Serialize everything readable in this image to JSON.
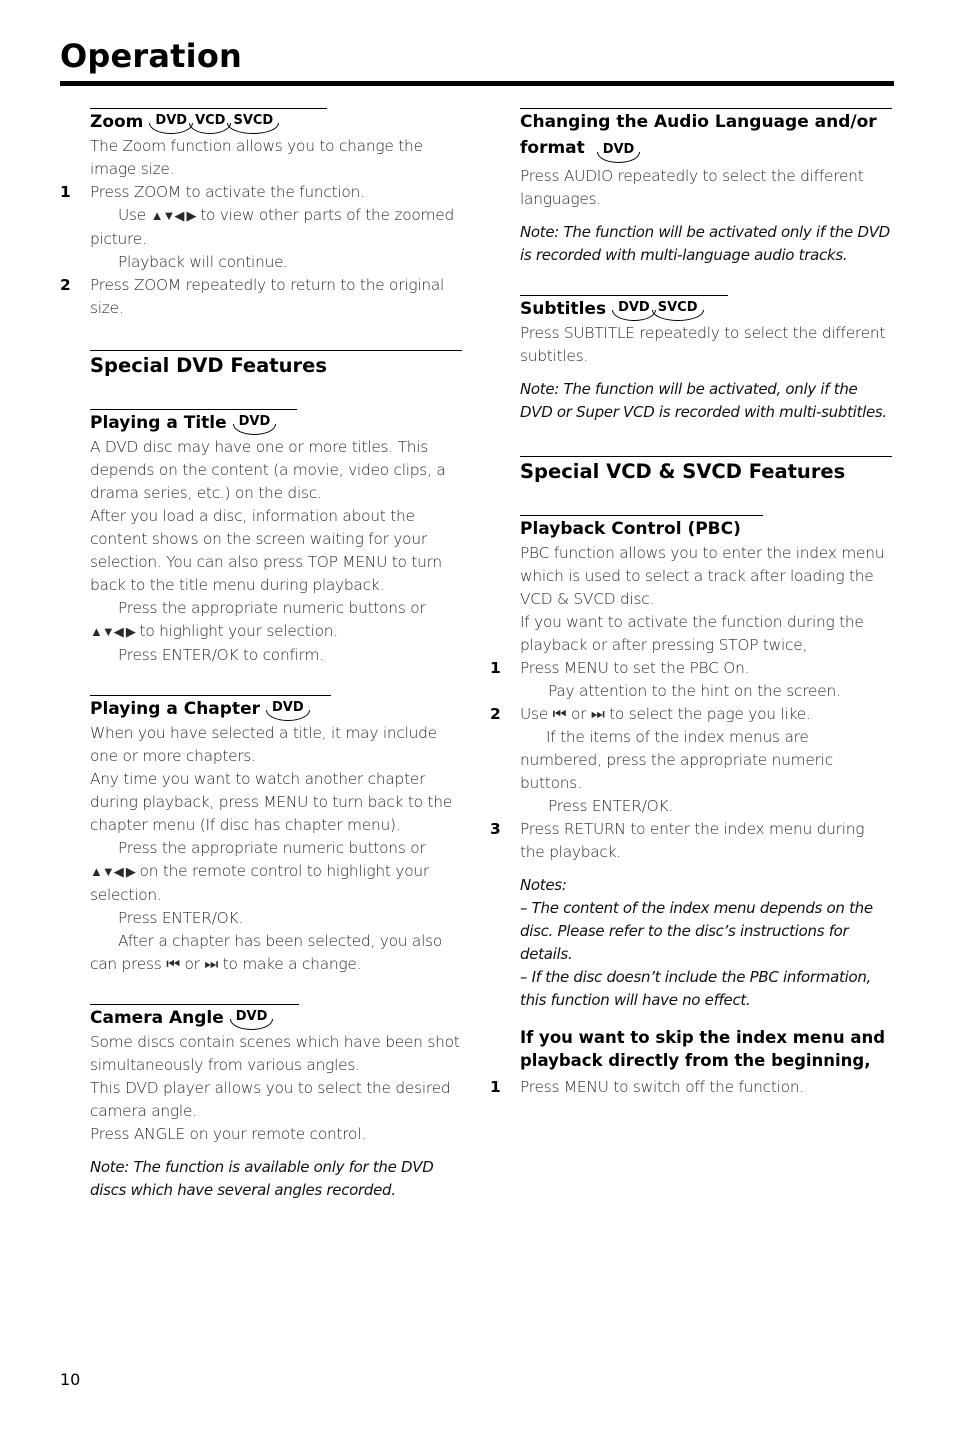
{
  "page": {
    "title": "Operation",
    "number": "10"
  },
  "zoom": {
    "heading": "Zoom",
    "badges": [
      "DVD",
      "VCD",
      "SVCD"
    ],
    "intro": "The Zoom function allows you to change the image size.",
    "step1_num": "1",
    "step1": "Press ZOOM to activate the function.",
    "step1_sub_pre": "Use",
    "arrows": "▲▼◀ ▶",
    "step1_sub_post": "to view other parts of the zoomed picture.",
    "step1_sub2": "Playback will continue.",
    "step2_num": "2",
    "step2": "Press ZOOM repeatedly to return to the original size."
  },
  "special_dvd": {
    "heading": "Special DVD Features"
  },
  "playing_title": {
    "heading": "Playing a Title",
    "badge": "DVD",
    "p1": "A DVD disc may have one or more titles. This depends on the content (a movie, video clips, a drama series, etc.) on the disc.",
    "p2": "After you load a disc, information about the content shows on the screen waiting for your selection. You can also press TOP MENU to turn back to the title menu during playback.",
    "p3_pre": "Press the appropriate numeric buttons or",
    "arrows": "▲▼◀ ▶",
    "p3_post": "to highlight your selection.",
    "p4": "Press ENTER/OK to confirm."
  },
  "playing_chapter": {
    "heading": "Playing a Chapter",
    "badge": "DVD",
    "p1": "When you have selected a title, it may include one or more chapters.",
    "p2": "Any time you want to watch another chapter during playback, press MENU to turn back to the chapter menu (If disc has chapter menu).",
    "p3_pre": "Press the appropriate numeric buttons or",
    "arrows": "▲▼◀ ▶",
    "p3_post": "on the remote control to highlight your selection.",
    "p4": "Press ENTER/OK.",
    "p5_pre": "After a chapter has been selected, you also can press",
    "prev_icon": "⏮",
    "or": "or",
    "next_icon": "⏭",
    "p5_post": "to make a change."
  },
  "camera_angle": {
    "heading": "Camera Angle",
    "badge": "DVD",
    "p1": "Some discs contain scenes which have been shot simultaneously from various angles.",
    "p2": "This DVD player allows you to select the desired camera angle.",
    "p3": "Press ANGLE on your remote control.",
    "note": "Note: The function is available only for the DVD discs which have several angles recorded."
  },
  "audio_language": {
    "heading_line1": "Changing the Audio Language and/or",
    "heading_line2": "format",
    "badge": "DVD",
    "p1": "Press AUDIO repeatedly to select the different languages.",
    "note": "Note: The function will be activated only if the DVD is recorded with multi-language audio tracks."
  },
  "subtitles": {
    "heading": "Subtitles",
    "badges": [
      "DVD",
      "SVCD"
    ],
    "p1": "Press SUBTITLE repeatedly to select the different subtitles.",
    "note": "Note: The function will be activated, only if the DVD or Super VCD is recorded with multi-subtitles."
  },
  "special_vcd": {
    "heading": "Special VCD & SVCD Features"
  },
  "pbc": {
    "heading": "Playback Control (PBC)",
    "p1": "PBC function allows you to enter the index menu which is used to select a track after loading the VCD & SVCD disc.",
    "p2": "If you want to activate the function during the playback or after pressing STOP twice,",
    "step1_num": "1",
    "step1": "Press MENU to set the PBC On.",
    "step1_sub": "Pay attention to the hint on the screen.",
    "step2_num": "2",
    "step2_pre": "Use",
    "prev_icon": "⏮",
    "or": "or",
    "next_icon": "⏭",
    "step2_post": "to select the page you like.",
    "step2_sub1": "If the items of the index menus are numbered, press the appropriate numeric buttons.",
    "step2_sub2": "Press ENTER/OK.",
    "step3_num": "3",
    "step3": "Press RETURN to enter the index menu during the playback.",
    "notes_label": "Notes:",
    "note1": "–  The content of the index menu depends on the disc. Please refer to the disc’s instructions for details.",
    "note2": "–  If the disc doesn’t include the PBC information, this function will have no effect.",
    "skip_heading": "If you want to skip the index menu and playback directly from the beginning,",
    "skip_step_num": "1",
    "skip_step": "Press MENU to switch off the function."
  }
}
